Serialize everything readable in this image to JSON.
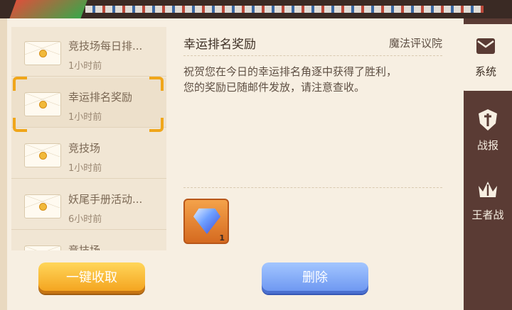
{
  "mail_list": [
    {
      "title": "竞技场每日排...",
      "time": "1小时前"
    },
    {
      "title": "幸运排名奖励",
      "time": "1小时前",
      "selected": true
    },
    {
      "title": "竞技场",
      "time": "1小时前"
    },
    {
      "title": "妖尾手册活动...",
      "time": "6小时前"
    },
    {
      "title": "竞技场",
      "time": ""
    }
  ],
  "detail": {
    "title": "幸运排名奖励",
    "sender": "魔法评议院",
    "body_line1": "祝贺您在今日的幸运排名角逐中获得了胜利，",
    "body_line2": "您的奖励已随邮件发放，请注意查收。",
    "attachment": {
      "icon": "diamond-icon",
      "count": "1"
    }
  },
  "buttons": {
    "collect_all": "一键收取",
    "delete": "删除"
  },
  "tabs": [
    {
      "label": "系统",
      "icon": "mail-icon",
      "active": true
    },
    {
      "label": "战报",
      "icon": "sword-shield-icon"
    },
    {
      "label": "王者战",
      "icon": "crown-sword-icon"
    }
  ],
  "colors": {
    "panel_bg": "#f7efe2",
    "selection_accent": "#f0a61a",
    "collect_button": "#f3a01b",
    "delete_button": "#6a94f0",
    "sidebar_bg": "#5a3b34"
  }
}
